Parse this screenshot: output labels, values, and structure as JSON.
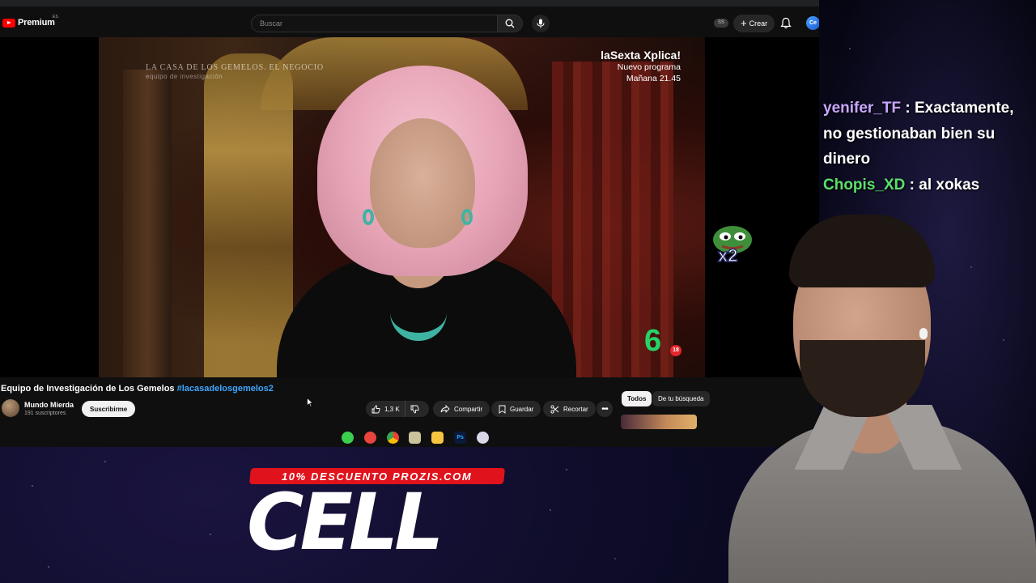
{
  "youtube": {
    "logo_text": "Premium",
    "region": "ES",
    "search_placeholder": "Buscar",
    "ss_badge": "SS",
    "create_label": "Crear",
    "avatar_initials": "Ce"
  },
  "video": {
    "overlay_title": "LA CASA DE LOS GEMELOS. EL NEGOCIO",
    "overlay_subtitle": "equipo de investigación",
    "promo_title": "laSexta Xplica!",
    "promo_line1": "Nuevo programa",
    "promo_line2": "Mañana 21.45",
    "channel_logo": "6",
    "age_rating": "18",
    "title": "Equipo de Investigación de Los Gemelos",
    "hashtag": "#lacasadelosgemelos2"
  },
  "channel": {
    "name": "Mundo Mierda",
    "subscribers": "191 suscriptores",
    "subscribe_label": "Suscribirme"
  },
  "actions": {
    "likes": "1,3 K",
    "share_label": "Compartir",
    "save_label": "Guardar",
    "clip_label": "Recortar"
  },
  "filters": {
    "all_label": "Todos",
    "search_label": "De tu búsqueda"
  },
  "dock": {
    "ps_label": "Ps"
  },
  "chat": {
    "messages": [
      {
        "user": "yenifer_TF",
        "text": ": Exactamente, no gestionaban bien su dinero"
      },
      {
        "user": "Chopis_XD",
        "text": ": al xokas"
      }
    ],
    "emote_text": "x2"
  },
  "sponsor": {
    "banner": "10% DESCUENTO PROZIS.COM",
    "word": "CELL"
  },
  "colors": {
    "youtube_red": "#ff0000",
    "link_blue": "#3ea6ff",
    "chat_user_purple": "#c9a6ff",
    "chat_user_green": "#5ce06a",
    "sponsor_red": "#e0121c"
  }
}
